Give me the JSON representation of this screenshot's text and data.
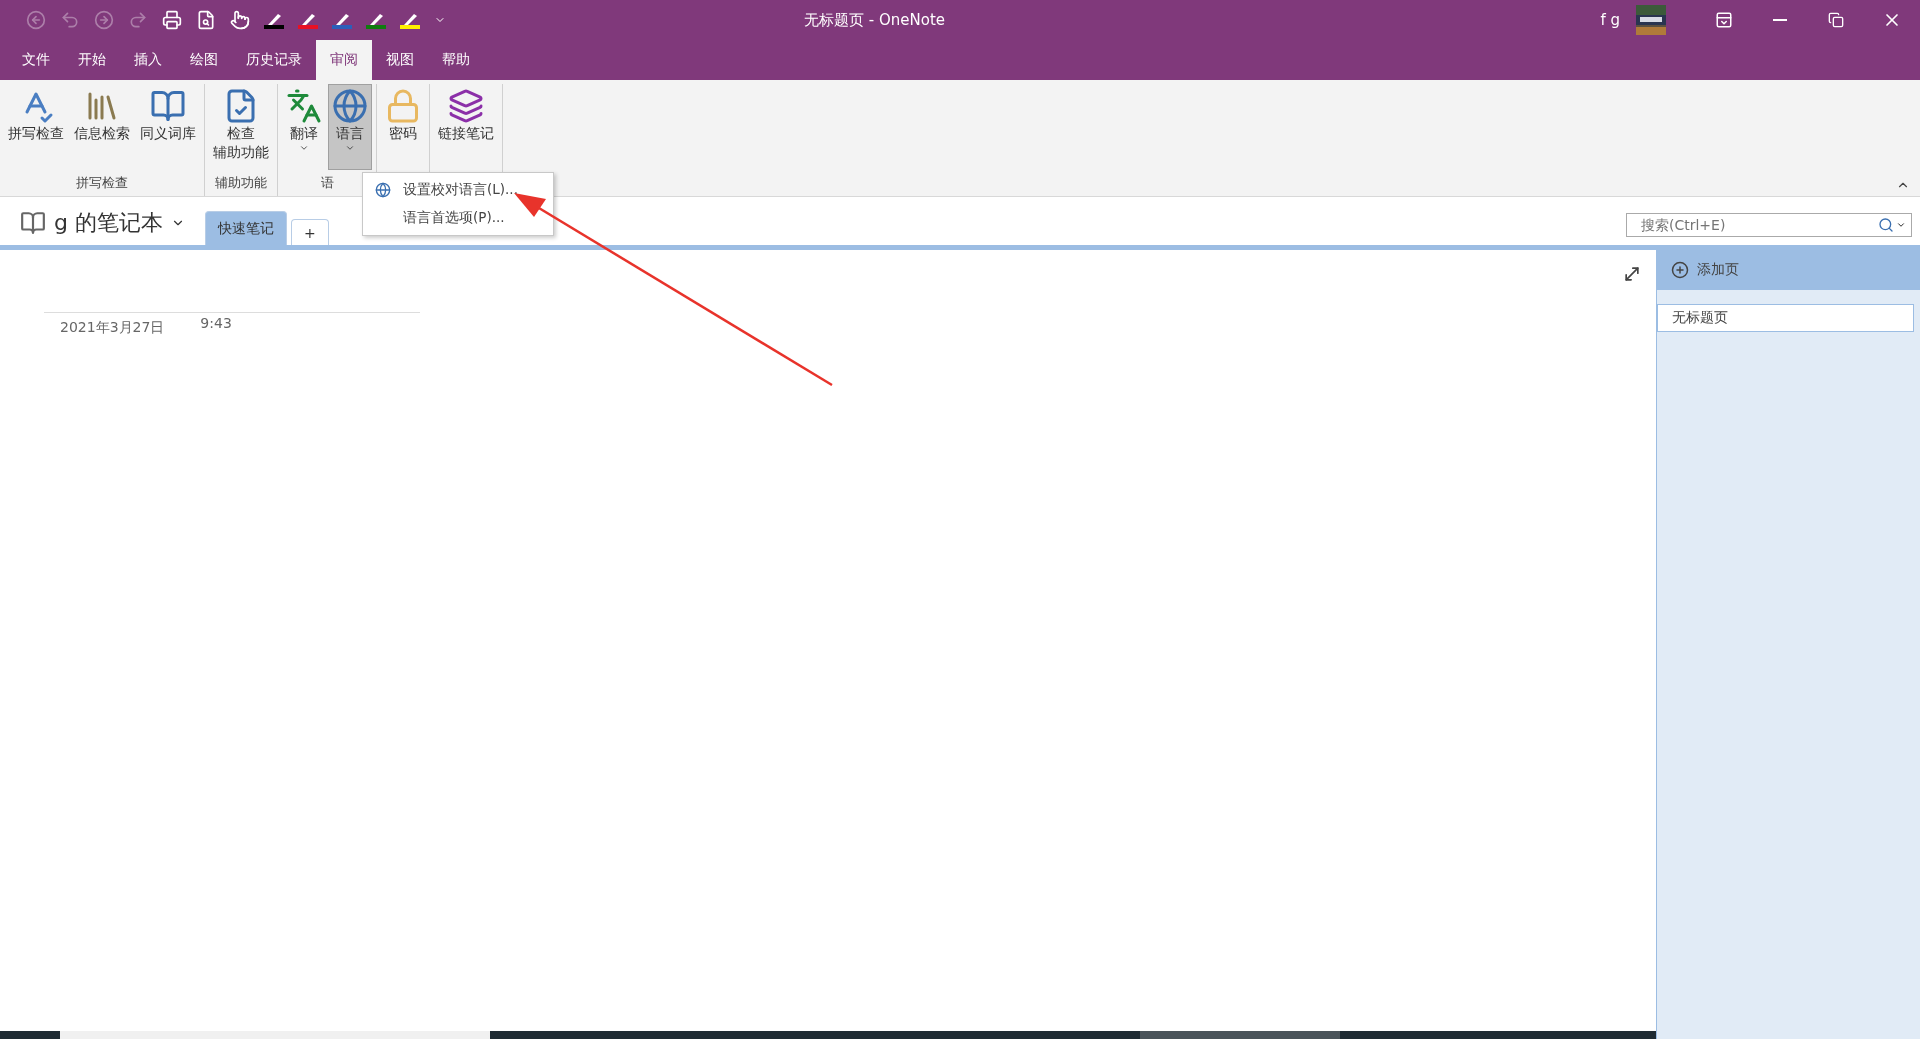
{
  "window": {
    "title": "无标题页 - OneNote",
    "user": "f g"
  },
  "quick_access": [
    {
      "kind": "back",
      "disabled": true
    },
    {
      "kind": "undo",
      "disabled": true
    },
    {
      "kind": "forward",
      "disabled": true
    },
    {
      "kind": "redo",
      "disabled": true
    },
    {
      "kind": "print",
      "disabled": false
    },
    {
      "kind": "preview",
      "disabled": false
    },
    {
      "kind": "touch",
      "disabled": false
    },
    {
      "kind": "pen",
      "color": "#000000",
      "disabled": false
    },
    {
      "kind": "pen",
      "color": "#e81123",
      "disabled": false
    },
    {
      "kind": "pen",
      "color": "#2b5fba",
      "disabled": false
    },
    {
      "kind": "pen",
      "color": "#107c10",
      "disabled": false
    },
    {
      "kind": "pen",
      "color": "#fff100",
      "disabled": false
    },
    {
      "kind": "customize",
      "disabled": false
    }
  ],
  "menu_tabs": [
    {
      "label": "文件",
      "selected": false
    },
    {
      "label": "开始",
      "selected": false
    },
    {
      "label": "插入",
      "selected": false
    },
    {
      "label": "绘图",
      "selected": false
    },
    {
      "label": "历史记录",
      "selected": false
    },
    {
      "label": "审阅",
      "selected": true
    },
    {
      "label": "视图",
      "selected": false
    },
    {
      "label": "帮助",
      "selected": false
    }
  ],
  "ribbon_groups": [
    {
      "label": "拼写检查",
      "buttons": [
        {
          "lines": [
            "拼写检查"
          ],
          "dropdown": false,
          "pressed": false
        },
        {
          "lines": [
            "信息检索"
          ],
          "dropdown": false,
          "pressed": false
        },
        {
          "lines": [
            "同义词库"
          ],
          "dropdown": false,
          "pressed": false
        }
      ]
    },
    {
      "label": "辅助功能",
      "buttons": [
        {
          "lines": [
            "检查",
            "辅助功能"
          ],
          "dropdown": false,
          "pressed": false
        }
      ]
    },
    {
      "label": "语",
      "buttons": [
        {
          "lines": [
            "翻译"
          ],
          "dropdown": true,
          "pressed": false
        },
        {
          "lines": [
            "语言"
          ],
          "dropdown": true,
          "pressed": true
        }
      ]
    },
    {
      "buttons": [
        {
          "lines": [
            "密码"
          ],
          "dropdown": false,
          "pressed": false
        }
      ]
    },
    {
      "buttons": [
        {
          "lines": [
            "链接笔记"
          ],
          "dropdown": false,
          "pressed": false
        }
      ]
    }
  ],
  "dropdown_menu": [
    {
      "label": "设置校对语言(L)...",
      "icon": true
    },
    {
      "label": "语言首选项(P)...",
      "icon": false
    }
  ],
  "notebook": {
    "name": "g 的笔记本",
    "sections": [
      {
        "label": "快速笔记",
        "selected": true
      }
    ],
    "add_section": "+"
  },
  "search": {
    "placeholder": "搜索(Ctrl+E)"
  },
  "page": {
    "date": "2021年3月27日",
    "time": "9:43"
  },
  "pages_pane": {
    "add_page": "添加页",
    "pages": [
      {
        "title": "无标题页",
        "selected": true
      }
    ]
  }
}
